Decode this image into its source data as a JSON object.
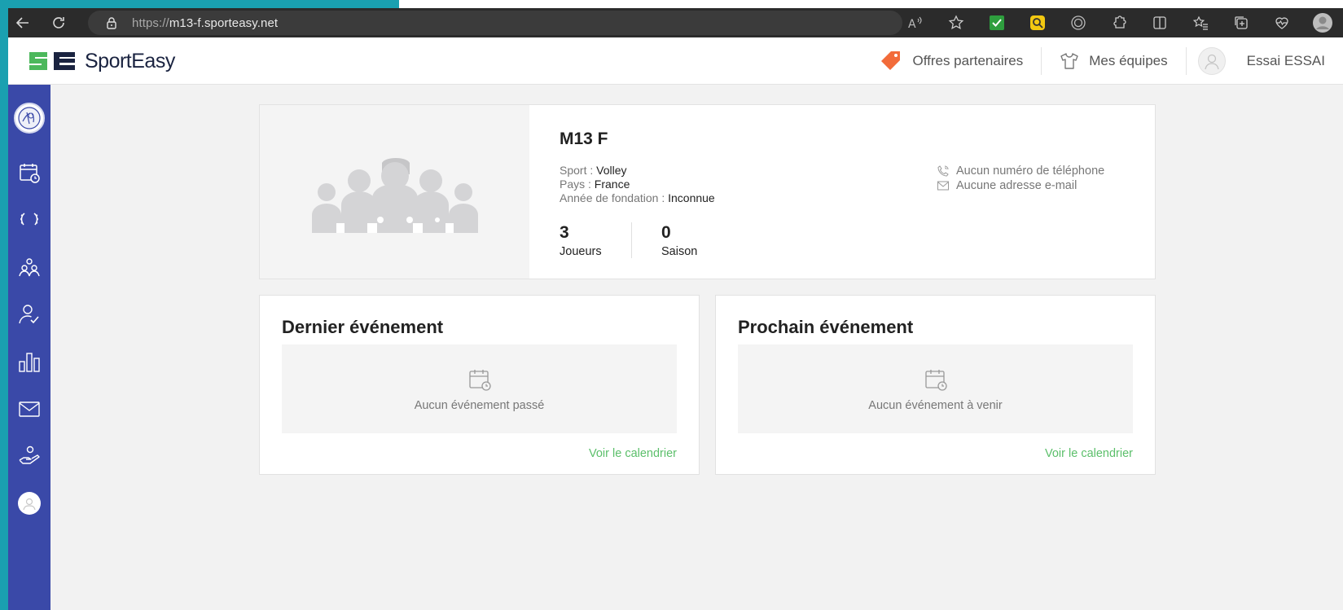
{
  "browser": {
    "url_protocol": "https://",
    "url_host": "m13-f.sporteasy.net"
  },
  "header": {
    "brand": "SportEasy",
    "partner_offers": "Offres partenaires",
    "my_teams": "Mes équipes",
    "user_name": "Essai ESSAI"
  },
  "sidebar": {
    "items": [
      "team-badge",
      "calendar-icon",
      "trophy-laurel-icon",
      "team-members-icon",
      "attendance-icon",
      "stats-icon",
      "mail-icon",
      "sponsors-icon",
      "profile-icon"
    ]
  },
  "team": {
    "name": "M13 F",
    "sport_label": "Sport : ",
    "sport_value": "Volley",
    "country_label": "Pays : ",
    "country_value": "France",
    "founded_label": "Année de fondation : ",
    "founded_value": "Inconnue",
    "phone": "Aucun numéro de téléphone",
    "email": "Aucune adresse e-mail",
    "players_count": "3",
    "players_label": "Joueurs",
    "seasons_count": "0",
    "seasons_label": "Saison"
  },
  "last_event": {
    "title": "Dernier événement",
    "empty_text": "Aucun événement passé",
    "link": "Voir le calendrier"
  },
  "next_event": {
    "title": "Prochain événement",
    "empty_text": "Aucun événement à venir",
    "link": "Voir le calendrier"
  },
  "colors": {
    "sidebar": "#3a49a8",
    "accent_green": "#5bbf6a",
    "partner_tag": "#f26b3a",
    "desktop": "#1aa0b0"
  }
}
